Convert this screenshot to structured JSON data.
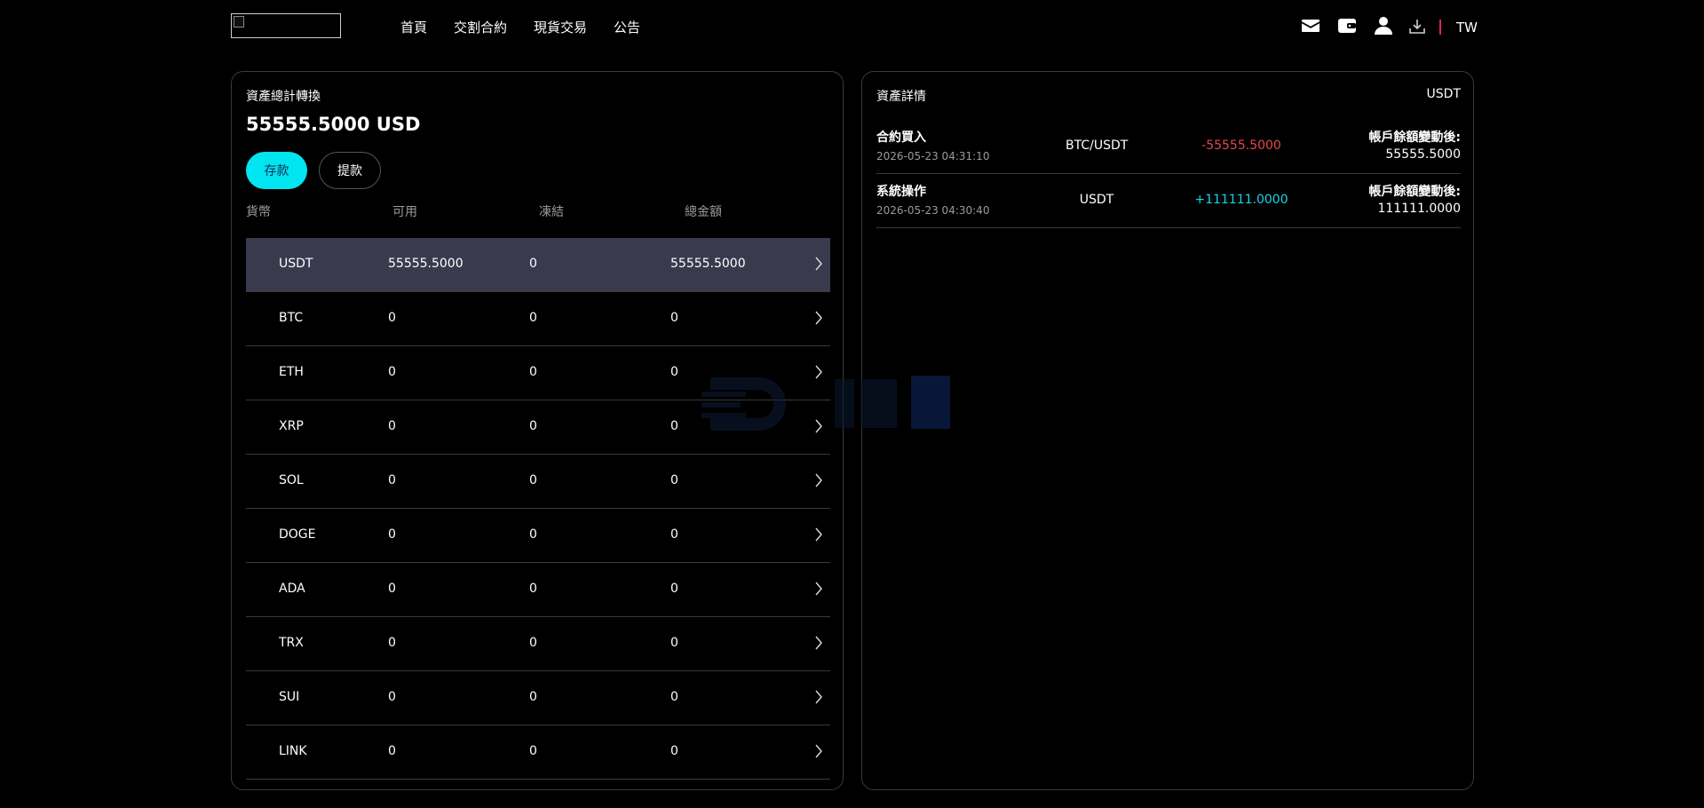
{
  "header": {
    "nav": [
      "首頁",
      "交割合約",
      "現貨交易",
      "公告"
    ],
    "icons": [
      "mail-icon",
      "wallet-icon",
      "user-icon",
      "download-icon"
    ],
    "language": "TW"
  },
  "assets": {
    "title": "資產總計轉換",
    "total": "55555.5000 USD",
    "deposit_label": "存款",
    "withdraw_label": "提款",
    "columns": [
      "貨幣",
      "可用",
      "凍結",
      "總金額"
    ],
    "rows": [
      {
        "coin": "USDT",
        "available": "55555.5000",
        "frozen": "0",
        "total": "55555.5000"
      },
      {
        "coin": "BTC",
        "available": "0",
        "frozen": "0",
        "total": "0"
      },
      {
        "coin": "ETH",
        "available": "0",
        "frozen": "0",
        "total": "0"
      },
      {
        "coin": "XRP",
        "available": "0",
        "frozen": "0",
        "total": "0"
      },
      {
        "coin": "SOL",
        "available": "0",
        "frozen": "0",
        "total": "0"
      },
      {
        "coin": "DOGE",
        "available": "0",
        "frozen": "0",
        "total": "0"
      },
      {
        "coin": "ADA",
        "available": "0",
        "frozen": "0",
        "total": "0"
      },
      {
        "coin": "TRX",
        "available": "0",
        "frozen": "0",
        "total": "0"
      },
      {
        "coin": "SUI",
        "available": "0",
        "frozen": "0",
        "total": "0"
      },
      {
        "coin": "LINK",
        "available": "0",
        "frozen": "0",
        "total": "0"
      }
    ]
  },
  "details": {
    "title": "資產詳情",
    "currency": "USDT",
    "records": [
      {
        "type": "合約買入",
        "time": "2026-05-23 04:31:10",
        "pair": "BTC/USDT",
        "amount": "-55555.5000",
        "balance_label": "帳戶餘額變動後:",
        "balance": "55555.5000"
      },
      {
        "type": "系統操作",
        "time": "2026-05-23 04:30:40",
        "pair": "USDT",
        "amount": "+111111.0000",
        "balance_label": "帳戶餘額變動後:",
        "balance": "111111.0000"
      }
    ]
  },
  "colors": {
    "accent": "#00e5f0",
    "negative": "#e5484d",
    "positive": "#19d3e3",
    "active_row": "#3a3a4e"
  }
}
